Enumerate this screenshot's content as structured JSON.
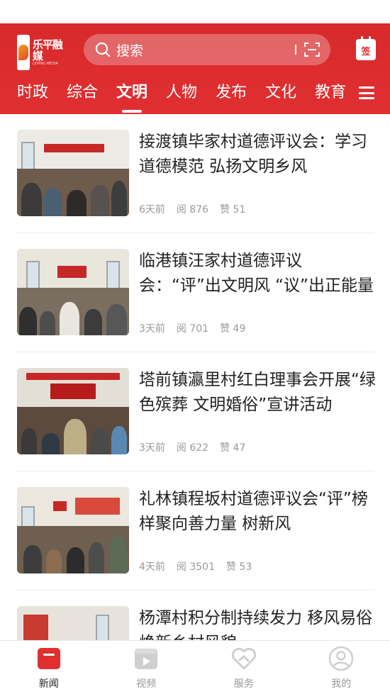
{
  "header": {
    "logo_text": "乐平融媒",
    "logo_sub": "LEPING MEDIA",
    "search_placeholder": "搜索",
    "checkin_label": "签"
  },
  "tabs": [
    {
      "label": "时政",
      "active": false
    },
    {
      "label": "综合",
      "active": false
    },
    {
      "label": "文明",
      "active": true
    },
    {
      "label": "人物",
      "active": false
    },
    {
      "label": "发布",
      "active": false
    },
    {
      "label": "文化",
      "active": false
    },
    {
      "label": "教育",
      "active": false
    }
  ],
  "articles": [
    {
      "title": "接渡镇毕家村道德评议会：学习道德模范 弘扬文明乡风",
      "time": "6天前",
      "reads": "阅 876",
      "likes": "赞 51"
    },
    {
      "title": "临港镇汪家村道德评议会：“评”出文明风 “议”出正能量",
      "time": "3天前",
      "reads": "阅 701",
      "likes": "赞 49"
    },
    {
      "title": "塔前镇瀛里村红白理事会开展“绿色殡葬 文明婚俗”宣讲活动",
      "time": "3天前",
      "reads": "阅 622",
      "likes": "赞 47"
    },
    {
      "title": "礼林镇程坂村道德评议会“评”榜样聚向善力量 树新风",
      "time": "4天前",
      "reads": "阅 3501",
      "likes": "赞 53"
    },
    {
      "title": "杨潭村积分制持续发力 移风易俗焕新乡村风貌",
      "time": "",
      "reads": "",
      "likes": ""
    }
  ],
  "bottom_nav": [
    {
      "label": "新闻",
      "icon": "news-icon",
      "active": true
    },
    {
      "label": "视频",
      "icon": "video-icon",
      "active": false
    },
    {
      "label": "服务",
      "icon": "service-heart-icon",
      "active": false
    },
    {
      "label": "我的",
      "icon": "profile-icon",
      "active": false
    }
  ],
  "colors": {
    "brand": "#e02f31",
    "text": "#222222",
    "meta": "#999999"
  }
}
